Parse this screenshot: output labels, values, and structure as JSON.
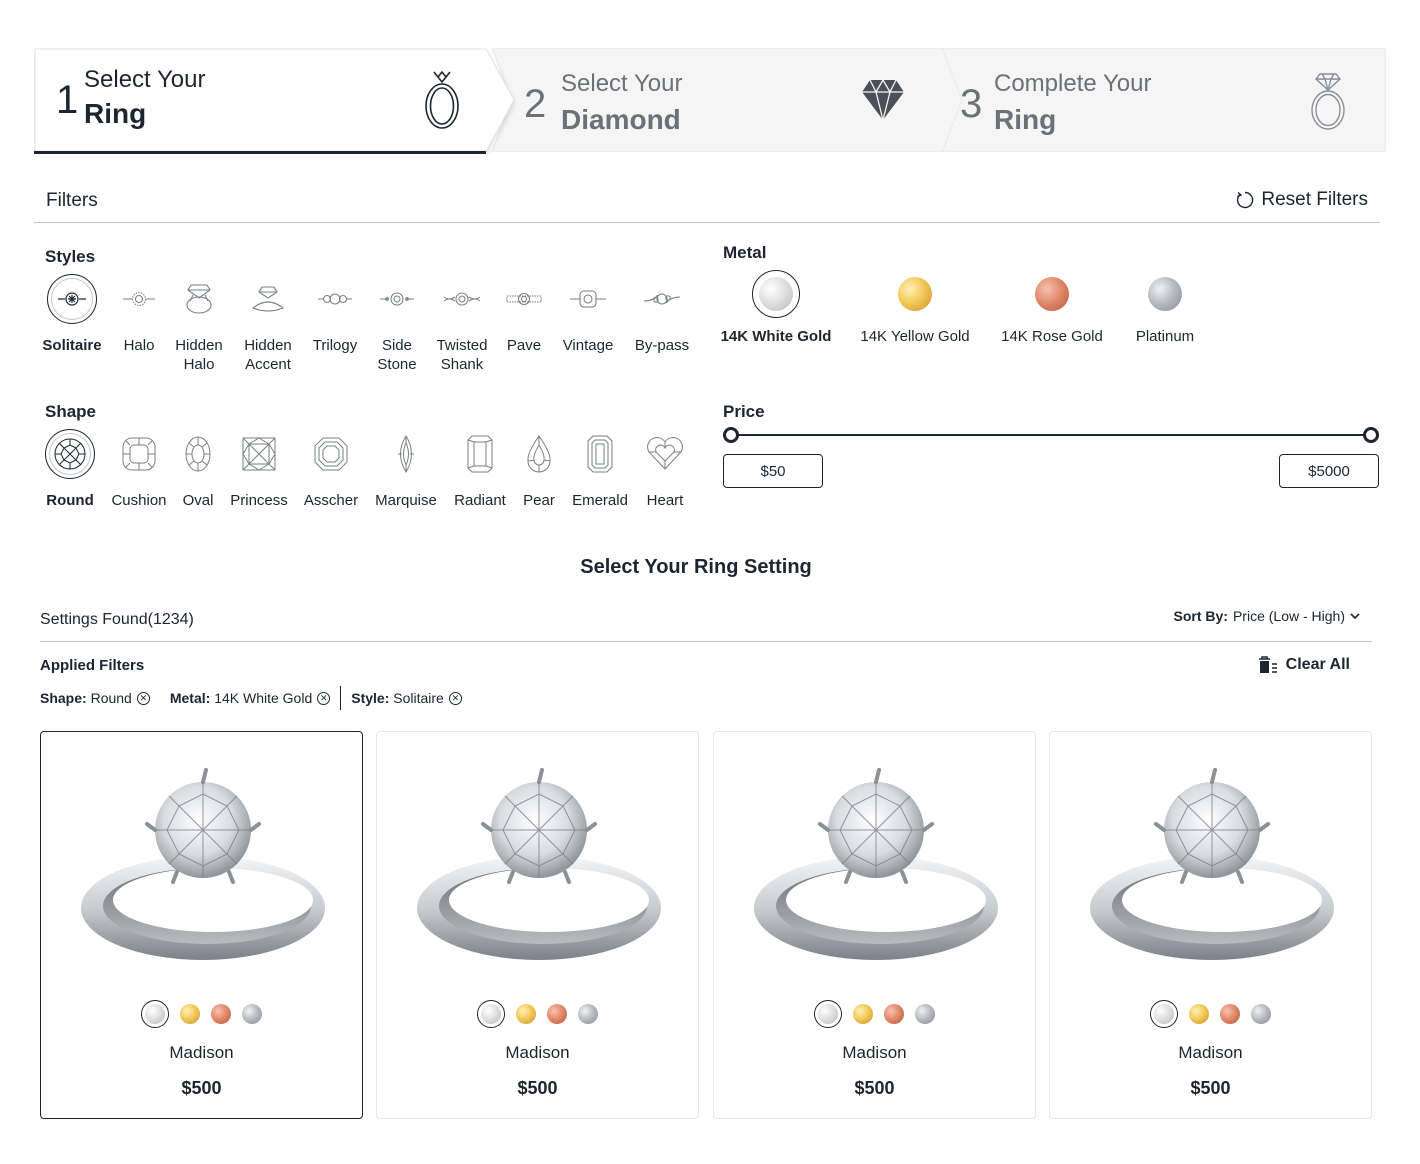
{
  "stepper": {
    "steps": [
      {
        "number": "1",
        "line1": "Select Your",
        "line2": "Ring",
        "icon": "ring-icon",
        "active": true
      },
      {
        "number": "2",
        "line1": "Select Your",
        "line2": "Diamond",
        "icon": "diamond-icon",
        "active": false
      },
      {
        "number": "3",
        "line1": "Complete Your",
        "line2": "Ring",
        "icon": "diamond-ring-icon",
        "active": false
      }
    ]
  },
  "filters": {
    "title": "Filters",
    "reset_label": "Reset Filters",
    "styles": {
      "label": "Styles",
      "selected": "Solitaire",
      "items": [
        {
          "line1": "Solitaire",
          "line2": ""
        },
        {
          "line1": "Halo",
          "line2": ""
        },
        {
          "line1": "Hidden",
          "line2": "Halo"
        },
        {
          "line1": "Hidden",
          "line2": "Accent"
        },
        {
          "line1": "Trilogy",
          "line2": ""
        },
        {
          "line1": "Side",
          "line2": "Stone"
        },
        {
          "line1": "Twisted",
          "line2": "Shank"
        },
        {
          "line1": "Pave",
          "line2": ""
        },
        {
          "line1": "Vintage",
          "line2": ""
        },
        {
          "line1": "By-pass",
          "line2": ""
        }
      ]
    },
    "metal": {
      "label": "Metal",
      "selected": "14K White Gold",
      "items": [
        {
          "label": "14K White Gold",
          "color": "#dcdcdc"
        },
        {
          "label": "14K Yellow Gold",
          "color": "#f2c85a"
        },
        {
          "label": "14K Rose Gold",
          "color": "#e28a6c"
        },
        {
          "label": "Platinum",
          "color": "#b8bcc2"
        }
      ]
    },
    "shape": {
      "label": "Shape",
      "selected": "Round",
      "items": [
        "Round",
        "Cushion",
        "Oval",
        "Princess",
        "Asscher",
        "Marquise",
        "Radiant",
        "Pear",
        "Emerald",
        "Heart"
      ]
    },
    "price": {
      "label": "Price",
      "min": "$50",
      "max": "$5000"
    }
  },
  "results": {
    "title": "Select Your Ring Setting",
    "found": "Settings Found(1234)",
    "sort_label": "Sort By:",
    "sort_value": "Price (Low - High)",
    "applied_label": "Applied Filters",
    "clear_all": "Clear All",
    "chips": [
      {
        "key": "Shape:",
        "value": "Round"
      },
      {
        "key": "Metal:",
        "value": "14K White Gold"
      },
      {
        "key": "Style:",
        "value": "Solitaire"
      }
    ],
    "cards": [
      {
        "name": "Madison",
        "price": "$500"
      },
      {
        "name": "Madison",
        "price": "$500"
      },
      {
        "name": "Madison",
        "price": "$500"
      },
      {
        "name": "Madison",
        "price": "$500"
      }
    ]
  },
  "colors": {
    "text": "#1c2530",
    "muted": "#6b7079",
    "step_inactive_bg": "#f5f5f5"
  }
}
